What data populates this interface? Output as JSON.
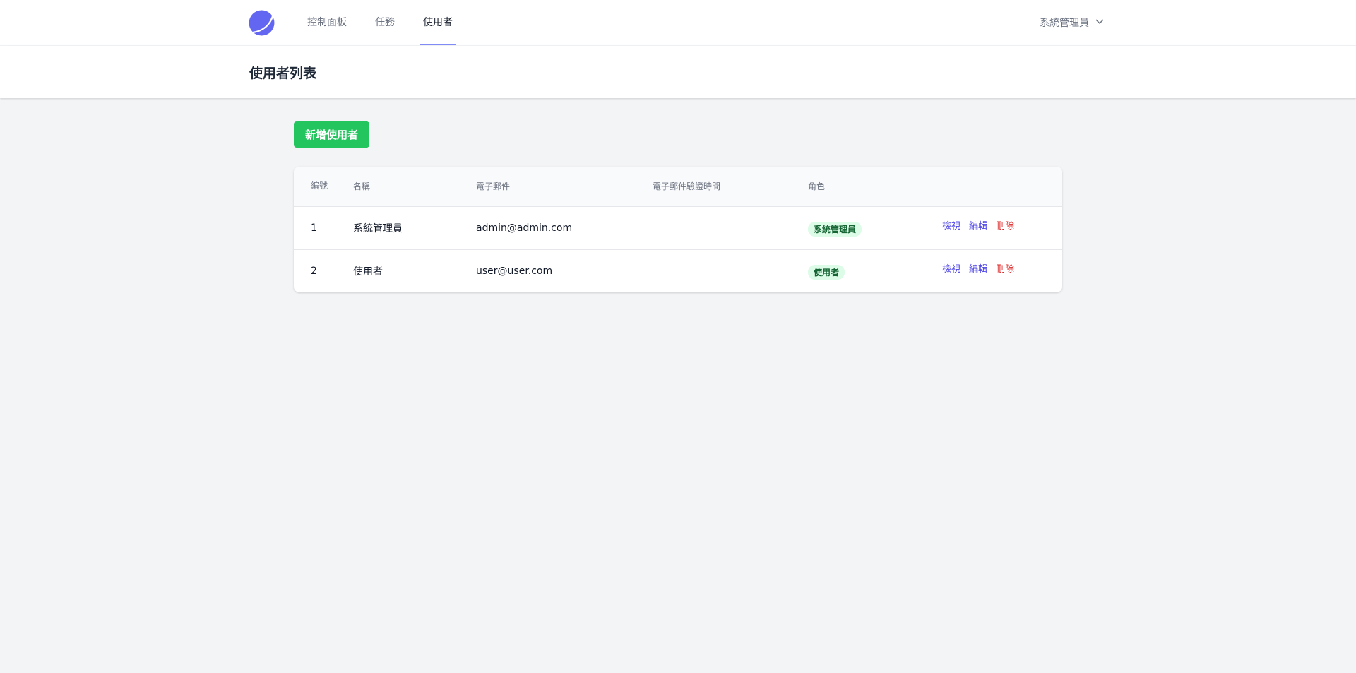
{
  "nav": {
    "items": [
      {
        "label": "控制面板",
        "active": false
      },
      {
        "label": "任務",
        "active": false
      },
      {
        "label": "使用者",
        "active": true
      }
    ],
    "user_name": "系統管理員"
  },
  "header": {
    "title": "使用者列表"
  },
  "toolbar": {
    "add_label": "新增使用者"
  },
  "table": {
    "columns": {
      "id": "編號",
      "name": "名稱",
      "email": "電子郵件",
      "verified_at": "電子郵件驗證時間",
      "role": "角色"
    },
    "rows": [
      {
        "id": "1",
        "name": "系統管理員",
        "email": "admin@admin.com",
        "verified_at": "",
        "role": "系統管理員",
        "actions": {
          "view": "檢視",
          "edit": "編輯",
          "delete": "刪除"
        }
      },
      {
        "id": "2",
        "name": "使用者",
        "email": "user@user.com",
        "verified_at": "",
        "role": "使用者",
        "actions": {
          "view": "檢視",
          "edit": "編輯",
          "delete": "刪除"
        }
      }
    ]
  },
  "colors": {
    "accent": "#6366f1",
    "add_button": "#22c55e",
    "badge_bg": "#dcfce7",
    "badge_text": "#166534",
    "delete": "#dc2626"
  },
  "icons": {
    "logo": "moon-logo-icon",
    "user_dropdown": "chevron-down-icon"
  }
}
